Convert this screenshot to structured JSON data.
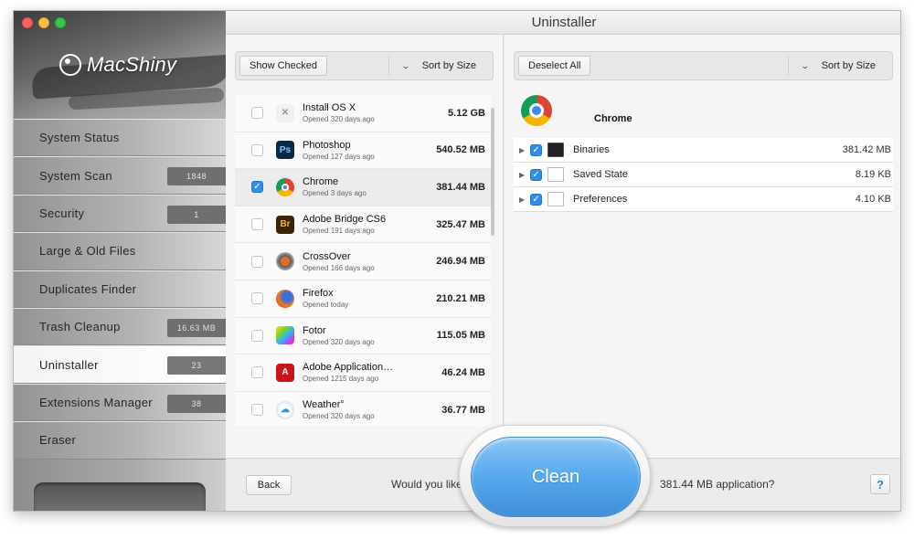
{
  "app": {
    "brand": "MacShiny",
    "window_title": "Uninstaller"
  },
  "sidebar": {
    "items": [
      {
        "label": "System Status",
        "badge": ""
      },
      {
        "label": "System Scan",
        "badge": "1848"
      },
      {
        "label": "Security",
        "badge": "1"
      },
      {
        "label": "Large & Old Files",
        "badge": ""
      },
      {
        "label": "Duplicates Finder",
        "badge": ""
      },
      {
        "label": "Trash Cleanup",
        "badge": "16.63 MB"
      },
      {
        "label": "Uninstaller",
        "badge": "23"
      },
      {
        "label": "Extensions Manager",
        "badge": "38"
      },
      {
        "label": "Eraser",
        "badge": ""
      }
    ],
    "active": "Uninstaller"
  },
  "left_pane": {
    "filter_button": "Show Checked",
    "sort_label": "Sort by Size",
    "apps": [
      {
        "name": "Install OS X",
        "opened": "Opened 320 days ago",
        "size": "5.12 GB",
        "checked": false,
        "icon": "install-osx-icon"
      },
      {
        "name": "Photoshop",
        "opened": "Opened 127 days ago",
        "size": "540.52 MB",
        "checked": false,
        "icon": "photoshop-icon"
      },
      {
        "name": "Chrome",
        "opened": "Opened 3 days ago",
        "size": "381.44 MB",
        "checked": true,
        "icon": "chrome-icon"
      },
      {
        "name": "Adobe Bridge CS6",
        "opened": "Opened 191 days ago",
        "size": "325.47 MB",
        "checked": false,
        "icon": "adobe-bridge-icon"
      },
      {
        "name": "CrossOver",
        "opened": "Opened 166 days ago",
        "size": "246.94 MB",
        "checked": false,
        "icon": "crossover-icon"
      },
      {
        "name": "Firefox",
        "opened": "Opened today",
        "size": "210.21 MB",
        "checked": false,
        "icon": "firefox-icon"
      },
      {
        "name": "Fotor",
        "opened": "Opened 320 days ago",
        "size": "115.05 MB",
        "checked": false,
        "icon": "fotor-icon"
      },
      {
        "name": "Adobe Application…",
        "opened": "Opened 1215 days ago",
        "size": "46.24 MB",
        "checked": false,
        "icon": "adobe-application-icon"
      },
      {
        "name": "Weather°",
        "opened": "Opened 320 days ago",
        "size": "36.77 MB",
        "checked": false,
        "icon": "weather-icon"
      }
    ]
  },
  "right_pane": {
    "deselect_button": "Deselect All",
    "sort_label": "Sort by Size",
    "app_name": "Chrome",
    "components": [
      {
        "label": "Binaries",
        "size": "381.42 MB",
        "checked": true,
        "icon": "terminal-icon"
      },
      {
        "label": "Saved State",
        "size": "8.19 KB",
        "checked": true,
        "icon": "document-icon"
      },
      {
        "label": "Preferences",
        "size": "4.10 KB",
        "checked": true,
        "icon": "document-icon"
      }
    ]
  },
  "footer": {
    "back_label": "Back",
    "prompt_before": "Would you like to",
    "clean_label": "Clean",
    "prompt_after": "381.44 MB application?",
    "help_label": "?"
  },
  "colors": {
    "accent": "#4a9ee8",
    "checkbox": "#2f8fe6"
  }
}
